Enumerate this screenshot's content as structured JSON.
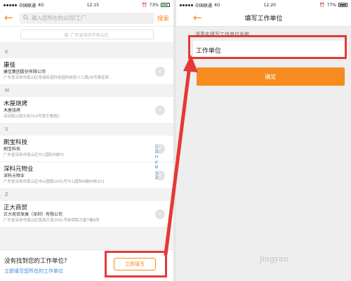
{
  "left": {
    "status": {
      "carrier": "中国联通",
      "network": "4G",
      "time": "12:15",
      "battery": "73%"
    },
    "search_placeholder": "输入您所在的公司/工厂",
    "search_button": "搜索",
    "location": "广东省深圳市南山区",
    "sections": [
      {
        "letter": "K",
        "items": [
          {
            "name": "康佳",
            "sub": "康佳集团股份有限公司",
            "addr": "广东省深圳市南山区粤海街道科技园科技南十二路28号康佳研..."
          }
        ]
      },
      {
        "letter": "M",
        "items": [
          {
            "name": "木屋烧烤",
            "sub": "木屋烧烤",
            "addr": "深圳南山南头街319号恩乐美居C"
          }
        ]
      },
      {
        "letter": "S",
        "items": [
          {
            "name": "刷宝科技",
            "sub": "刷宝科技",
            "addr": "广东省深圳市南山区TCL国际E城F5"
          },
          {
            "name": "深科元物业",
            "sub": "深科元物业",
            "addr": "广东省深圳市南山区中山园路1001号TCL国际E城B6栋101"
          }
        ]
      },
      {
        "letter": "Z",
        "items": [
          {
            "name": "正大商贸",
            "sub": "正大商贸发展（深圳）有限公司",
            "addr": "广东省深圳市南山区南海大道2061号新保辉大厦7楼6房"
          }
        ]
      }
    ],
    "index_letters": [
      "C",
      "D",
      "H",
      "K",
      "M",
      "S",
      "Z"
    ],
    "bottom": {
      "question": "没有找到您的工作单位?",
      "hint": "立即填写您所在的工作单位",
      "fill_button": "立即填写"
    }
  },
  "right": {
    "status": {
      "carrier": "中国联通",
      "network": "4G",
      "time": "12:20",
      "battery": "77%"
    },
    "title": "填写工作单位",
    "label": "请真实填写工作单位名称",
    "input_value": "工作单位",
    "confirm": "确定"
  },
  "watermark": "jingyan",
  "colors": {
    "accent": "#f68b1f",
    "highlight": "#e53935",
    "link": "#3a8be0"
  }
}
